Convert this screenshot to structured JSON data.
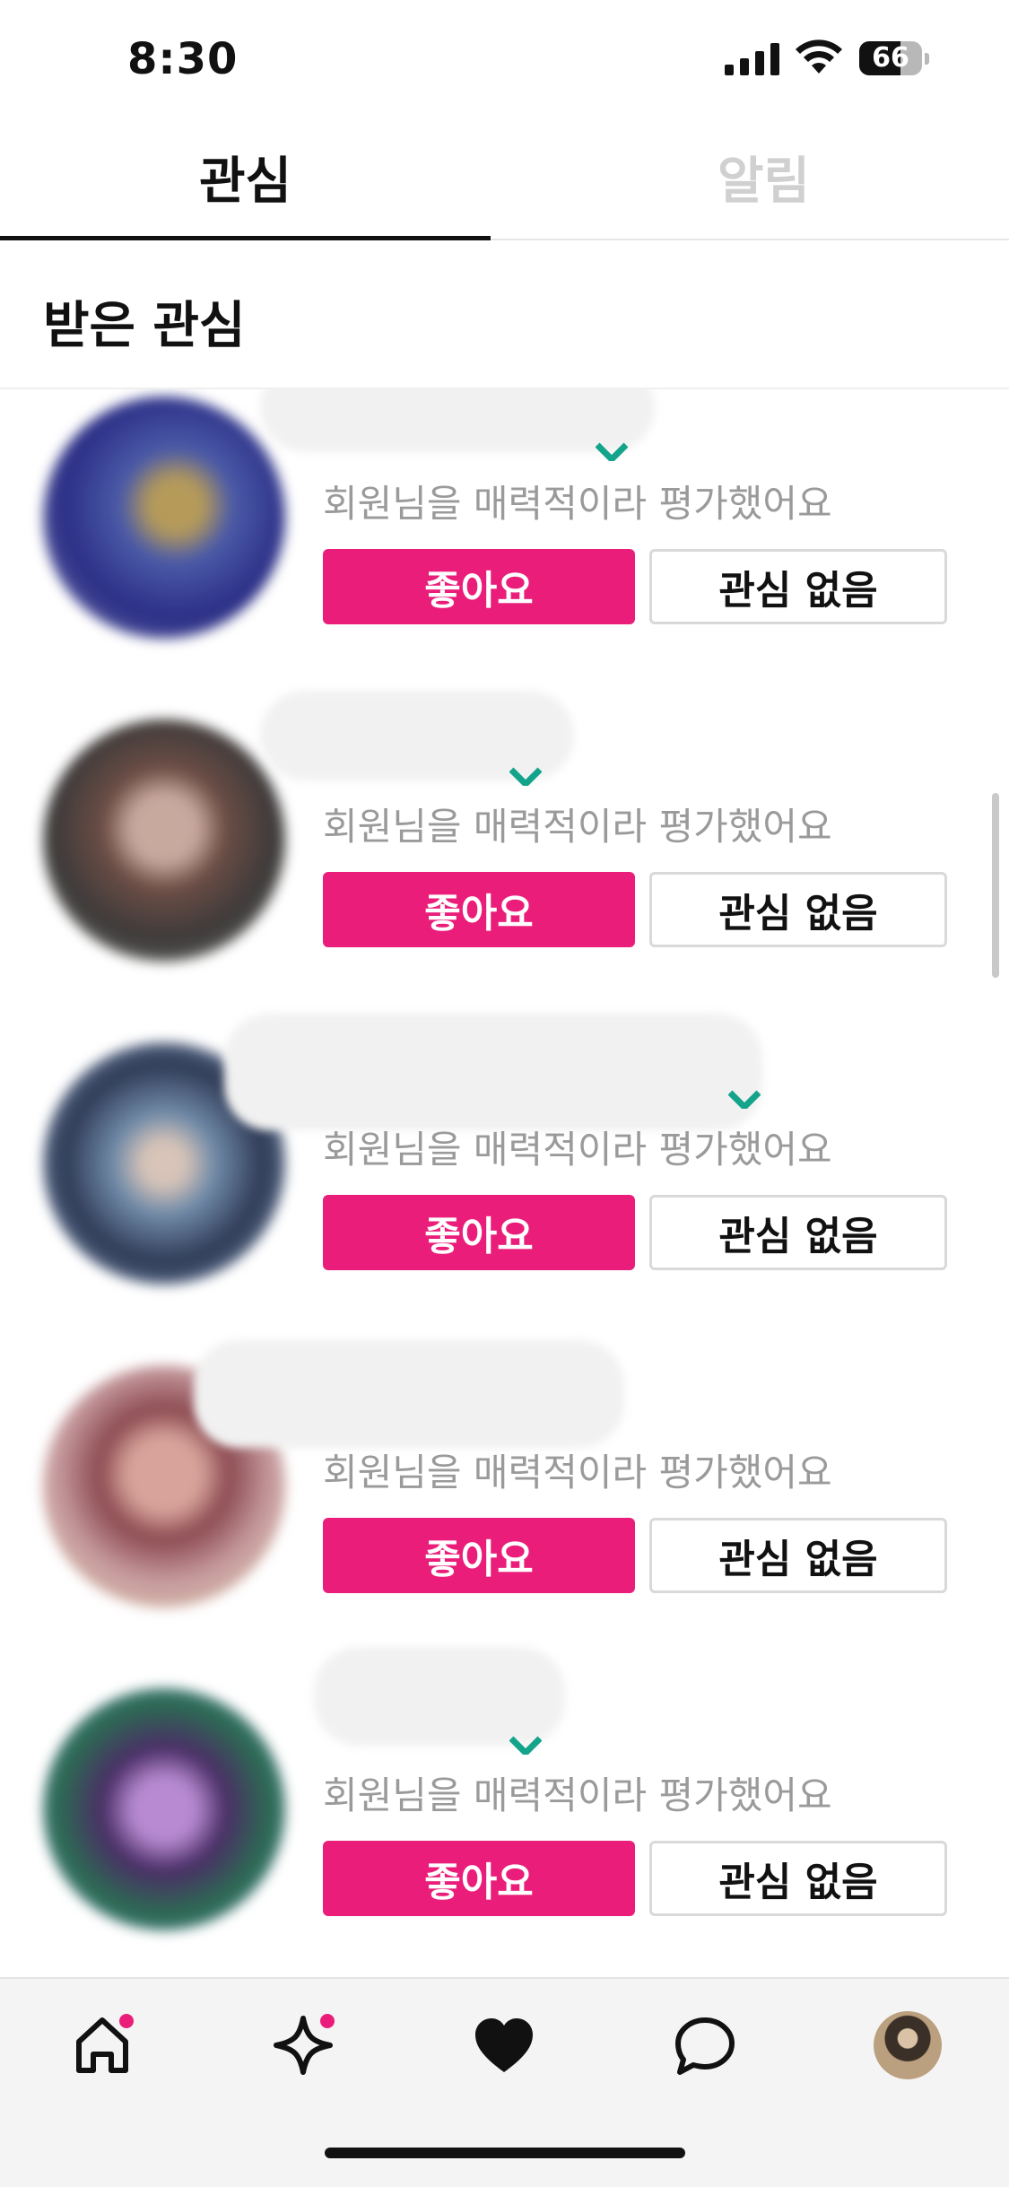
{
  "status_bar": {
    "time": "8:30",
    "battery_level": "66"
  },
  "tabs": [
    {
      "label": "관심",
      "active": true
    },
    {
      "label": "알림",
      "active": false
    }
  ],
  "section": {
    "title": "받은 관심"
  },
  "cards": [
    {
      "message": "회원님을 매력적이라 평가했어요",
      "like_label": "좋아요",
      "pass_label": "관심 없음"
    },
    {
      "message": "회원님을 매력적이라 평가했어요",
      "like_label": "좋아요",
      "pass_label": "관심 없음"
    },
    {
      "message": "회원님을 매력적이라 평가했어요",
      "like_label": "좋아요",
      "pass_label": "관심 없음"
    },
    {
      "message": "회원님을 매력적이라 평가했어요",
      "like_label": "좋아요",
      "pass_label": "관심 없음"
    },
    {
      "message": "회원님을 매력적이라 평가했어요",
      "like_label": "좋아요",
      "pass_label": "관심 없음"
    }
  ],
  "bottom_nav": {
    "items": [
      {
        "icon": "home-icon",
        "has_badge": true
      },
      {
        "icon": "sparkle-icon",
        "has_badge": true
      },
      {
        "icon": "heart-icon",
        "has_badge": false
      },
      {
        "icon": "chat-bubble-icon",
        "has_badge": false
      },
      {
        "icon": "profile-avatar",
        "has_badge": false
      }
    ]
  },
  "colors": {
    "accent": "#ea1e7a",
    "badge_teal": "#14a38b",
    "message_text": "#9a9a9a",
    "inactive_tab": "#d0d0d0"
  }
}
